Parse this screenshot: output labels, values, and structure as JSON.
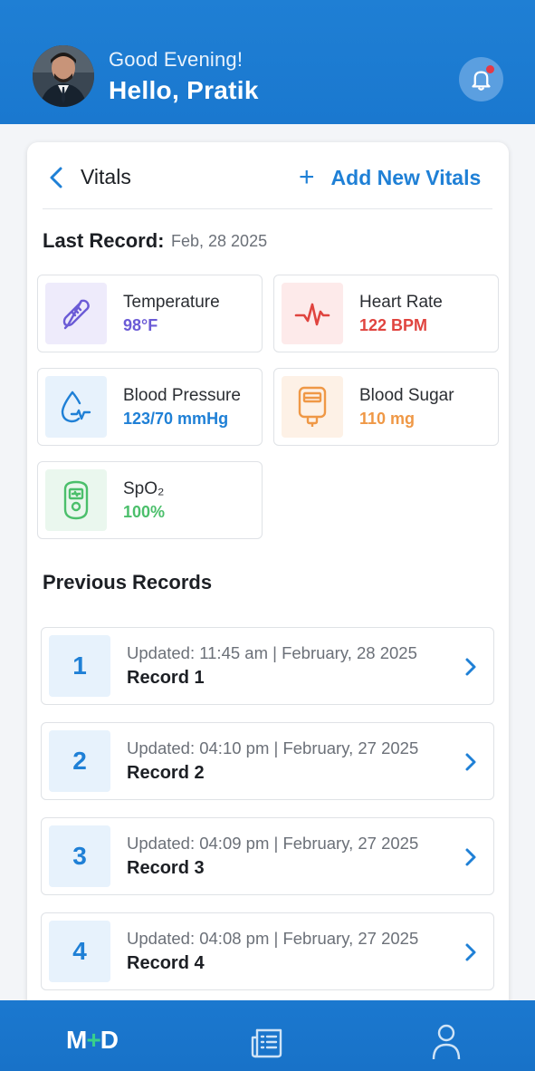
{
  "header": {
    "greeting": "Good Evening!",
    "hello": "Hello, Pratik",
    "avatar_icon": "user-avatar",
    "bell_icon": "bell-icon"
  },
  "vitals": {
    "title": "Vitals",
    "add_label": "Add New Vitals",
    "add_icon": "+",
    "last_record_label": "Last Record:",
    "last_record_date": "Feb, 28 2025",
    "tiles": [
      {
        "label": "Temperature",
        "value": "98°F",
        "color": "#6b5bd6",
        "bg": "#eeebfb",
        "icon": "thermometer-icon"
      },
      {
        "label": "Heart Rate",
        "value": "122 BPM",
        "color": "#e0443f",
        "bg": "#fdeaea",
        "icon": "heart-rate-icon"
      },
      {
        "label": "Blood Pressure",
        "value": "123/70 mmHg",
        "color": "#1f80d6",
        "bg": "#e7f2fc",
        "icon": "blood-pressure-icon"
      },
      {
        "label": "Blood Sugar",
        "value": "110 mg",
        "color": "#ef9846",
        "bg": "#fdf1e6",
        "icon": "glucometer-icon"
      },
      {
        "label": "SpO₂",
        "value": "100%",
        "color": "#4bbf6b",
        "bg": "#eaf7ee",
        "icon": "oximeter-icon"
      }
    ]
  },
  "previous": {
    "title": "Previous Records",
    "records": [
      {
        "num": "1",
        "updated": "Updated: 11:45 am | February, 28 2025",
        "name": "Record 1"
      },
      {
        "num": "2",
        "updated": "Updated: 04:10 pm | February, 27 2025",
        "name": "Record 2"
      },
      {
        "num": "3",
        "updated": "Updated: 04:09 pm | February, 27 2025",
        "name": "Record 3"
      },
      {
        "num": "4",
        "updated": "Updated: 04:08 pm | February, 27 2025",
        "name": "Record 4"
      }
    ]
  },
  "nav": {
    "logo_m": "M",
    "logo_plus": "+",
    "logo_d": "D",
    "records_icon": "records-icon",
    "profile_icon": "profile-icon"
  }
}
